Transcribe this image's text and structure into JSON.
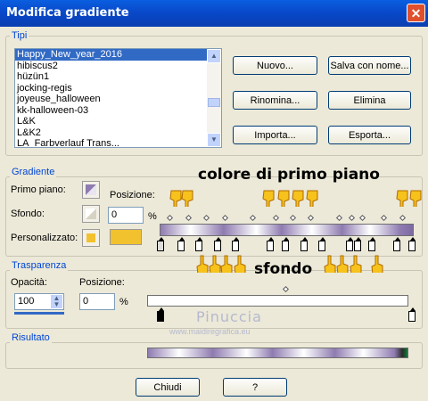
{
  "window": {
    "title": "Modifica gradiente",
    "close_glyph": "✕"
  },
  "tipi": {
    "label": "Tipi",
    "list": [
      "Happy_New_year_2016",
      "hibiscus2",
      "hüzün1",
      "jocking-regis",
      "joyeuse_halloween",
      "kk-halloween-03",
      "L&K",
      "L&K2",
      "LA_Farbverlauf Trans..."
    ],
    "selected_index": 0,
    "buttons": {
      "new": "Nuovo...",
      "save_as": "Salva con nome...",
      "rename": "Rinomina...",
      "delete": "Elimina",
      "import": "Importa...",
      "export": "Esporta..."
    }
  },
  "gradiente": {
    "label": "Gradiente",
    "foreground_label": "Primo piano:",
    "background_label": "Sfondo:",
    "custom_label": "Personalizzato:",
    "position_label": "Posizione:",
    "position_value": "0",
    "percent": "%",
    "custom_color": "#f2c12e"
  },
  "trasparenza": {
    "label": "Trasparenza",
    "opacity_label": "Opacità:",
    "opacity_value": "100",
    "position_label": "Posizione:",
    "position_value": "0",
    "percent": "%"
  },
  "risultato": {
    "label": "Risultato"
  },
  "annotations": {
    "foreground": "colore di primo piano",
    "background": "sfondo"
  },
  "watermark": {
    "name": "Pinuccia",
    "url": "www.maidiregrafica.eu"
  },
  "footer": {
    "close": "Chiudi",
    "help": "?"
  }
}
